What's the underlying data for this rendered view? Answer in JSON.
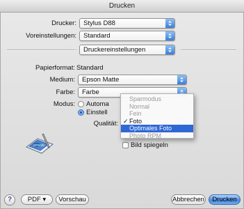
{
  "window": {
    "title": "Drucken"
  },
  "printer": {
    "label": "Drucker:",
    "value": "Stylus D88"
  },
  "presets": {
    "label": "Voreinstellungen:",
    "value": "Standard"
  },
  "panel": {
    "value": "Druckereinstellungen"
  },
  "paper_format": {
    "label": "Papierformat:",
    "value": "Standard"
  },
  "medium": {
    "label": "Medium:",
    "value": "Epson Matte"
  },
  "color": {
    "label": "Farbe:",
    "value": "Farbe"
  },
  "mode": {
    "label": "Modus:",
    "option_auto": "Automa",
    "option_custom": "Einstell",
    "selected": "Einstell"
  },
  "quality": {
    "label": "Qualität:",
    "menu_items": [
      {
        "label": "Sparmodus",
        "state": "disabled"
      },
      {
        "label": "Normal",
        "state": "disabled"
      },
      {
        "label": "Fein",
        "state": "disabled"
      },
      {
        "label": "Foto",
        "state": "checked"
      },
      {
        "label": "Optimales Foto",
        "state": "highlighted"
      },
      {
        "label": "Photo RPM",
        "state": "disabled"
      }
    ],
    "check_mark": "✓"
  },
  "mirror": {
    "label": "Bild spiegeln"
  },
  "buttons": {
    "help": "?",
    "pdf": "PDF ▾",
    "preview": "Vorschau",
    "cancel": "Abbrechen",
    "print": "Drucken"
  },
  "colors": {
    "accent": "#2f68d6",
    "default_button": "#4a8cdf"
  },
  "icons": {
    "epson_logo": "epson-printer-icon",
    "popup_arrows": "updown-arrows-icon"
  }
}
